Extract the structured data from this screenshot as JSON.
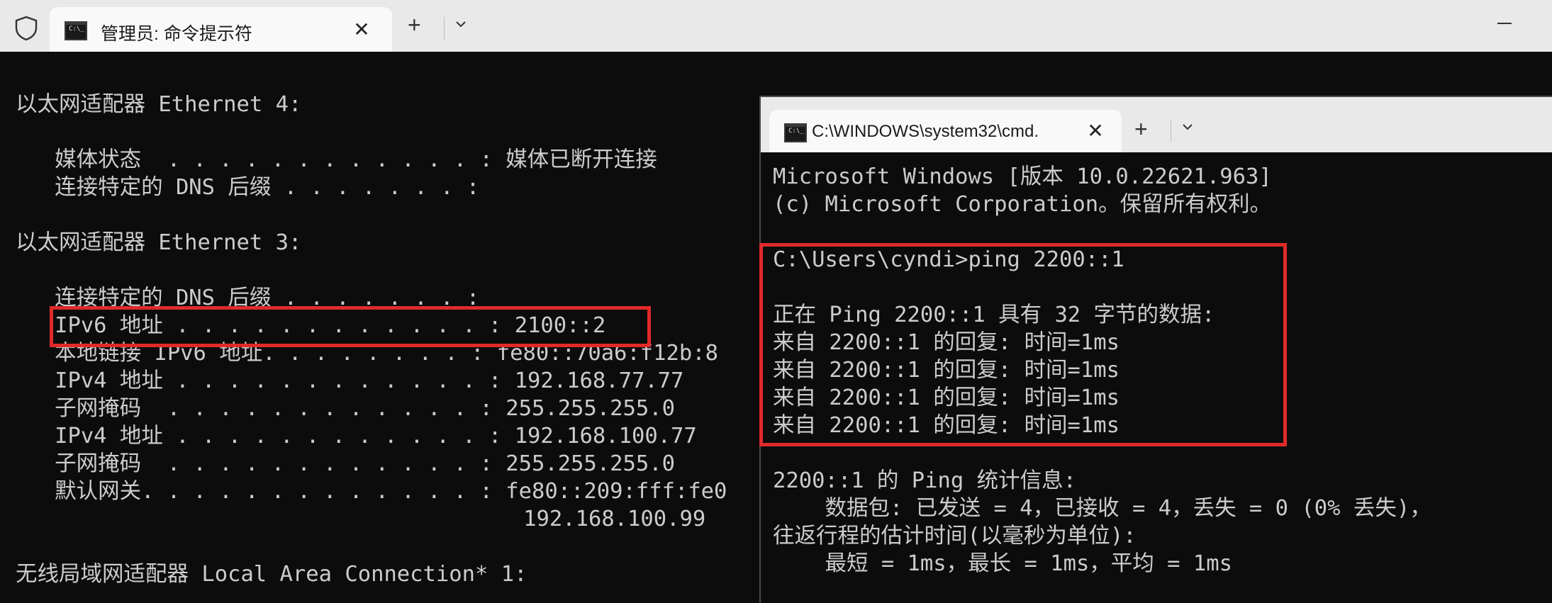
{
  "back_window": {
    "tab_title": "管理员: 命令提示符",
    "tab_icon_text": "C:\\_",
    "close_glyph": "✕",
    "new_tab_glyph": "+",
    "lines": [
      "以太网适配器 Ethernet 4:",
      "",
      "   媒体状态  . . . . . . . . . . . . : 媒体已断开连接",
      "   连接特定的 DNS 后缀 . . . . . . . :",
      "",
      "以太网适配器 Ethernet 3:",
      "",
      "   连接特定的 DNS 后缀 . . . . . . . :",
      "   IPv6 地址 . . . . . . . . . . . . : 2100::2",
      "   本地链接 IPv6 地址. . . . . . . . : fe80::70a6:f12b:8",
      "   IPv4 地址 . . . . . . . . . . . . : 192.168.77.77",
      "   子网掩码  . . . . . . . . . . . . : 255.255.255.0",
      "   IPv4 地址 . . . . . . . . . . . . : 192.168.100.77",
      "   子网掩码  . . . . . . . . . . . . : 255.255.255.0",
      "   默认网关. . . . . . . . . . . . . : fe80::209:fff:fe0",
      "                                       192.168.100.99",
      "",
      "无线局域网适配器 Local Area Connection* 1:"
    ]
  },
  "front_window": {
    "tab_title": "C:\\WINDOWS\\system32\\cmd.",
    "tab_icon_text": "C:\\_",
    "close_glyph": "✕",
    "new_tab_glyph": "+",
    "lines": [
      "Microsoft Windows [版本 10.0.22621.963]",
      "(c) Microsoft Corporation。保留所有权利。",
      "",
      "C:\\Users\\cyndi>ping 2200::1",
      "",
      "正在 Ping 2200::1 具有 32 字节的数据:",
      "来自 2200::1 的回复: 时间=1ms",
      "来自 2200::1 的回复: 时间=1ms",
      "来自 2200::1 的回复: 时间=1ms",
      "来自 2200::1 的回复: 时间=1ms",
      "",
      "2200::1 的 Ping 统计信息:",
      "    数据包: 已发送 = 4，已接收 = 4，丢失 = 0 (0% 丢失)，",
      "往返行程的估计时间(以毫秒为单位):",
      "    最短 = 1ms，最长 = 1ms，平均 = 1ms"
    ]
  },
  "colors": {
    "terminal_bg": "#0c0c0c",
    "terminal_fg": "#cccccc",
    "highlight": "#e02a2a",
    "titlebar": "#e9e9e9",
    "tab_active": "#f9f9f9"
  }
}
